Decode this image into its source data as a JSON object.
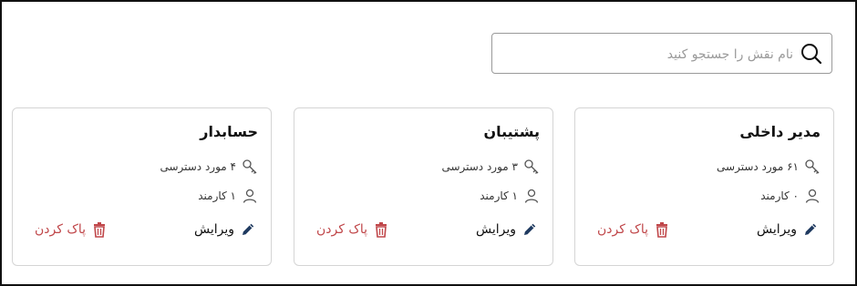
{
  "search": {
    "placeholder": "نام نقش را جستجو کنید",
    "value": ""
  },
  "roles": [
    {
      "title": "مدیر داخلی",
      "access_text": "۶۱ مورد دسترسی",
      "staff_text": "۰ کارمند",
      "edit_label": "ویرایش",
      "delete_label": "پاک کردن"
    },
    {
      "title": "پشتیبان",
      "access_text": "۳ مورد دسترسی",
      "staff_text": "۱ کارمند",
      "edit_label": "ویرایش",
      "delete_label": "پاک کردن"
    },
    {
      "title": "حسابدار",
      "access_text": "۴ مورد دسترسی",
      "staff_text": "۱ کارمند",
      "edit_label": "ویرایش",
      "delete_label": "پاک کردن"
    }
  ],
  "colors": {
    "delete": "#c0474a",
    "edit": "#1f3a60",
    "border": "#d5d5d5",
    "muted": "#9a9a9a"
  },
  "icons": {
    "search": "search-icon",
    "access": "key-icon",
    "staff": "user-icon",
    "edit": "pencil-icon",
    "delete": "trash-icon"
  }
}
